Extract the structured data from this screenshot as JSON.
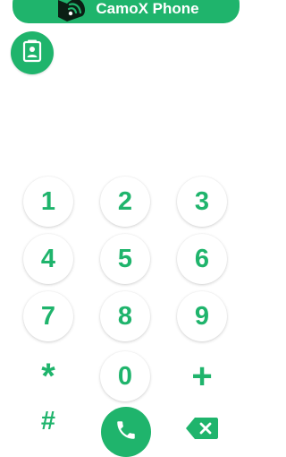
{
  "app": {
    "title": "CamoX Phone",
    "accent": "#1fb46c"
  },
  "icons": {
    "logo": "camox-phone-logo-icon",
    "contacts": "contact-card-icon",
    "call": "phone-handset-icon",
    "backspace": "backspace-icon"
  },
  "keypad": {
    "keys": [
      "1",
      "2",
      "3",
      "4",
      "5",
      "6",
      "7",
      "8",
      "9",
      "*",
      "0",
      "+",
      "#"
    ]
  }
}
